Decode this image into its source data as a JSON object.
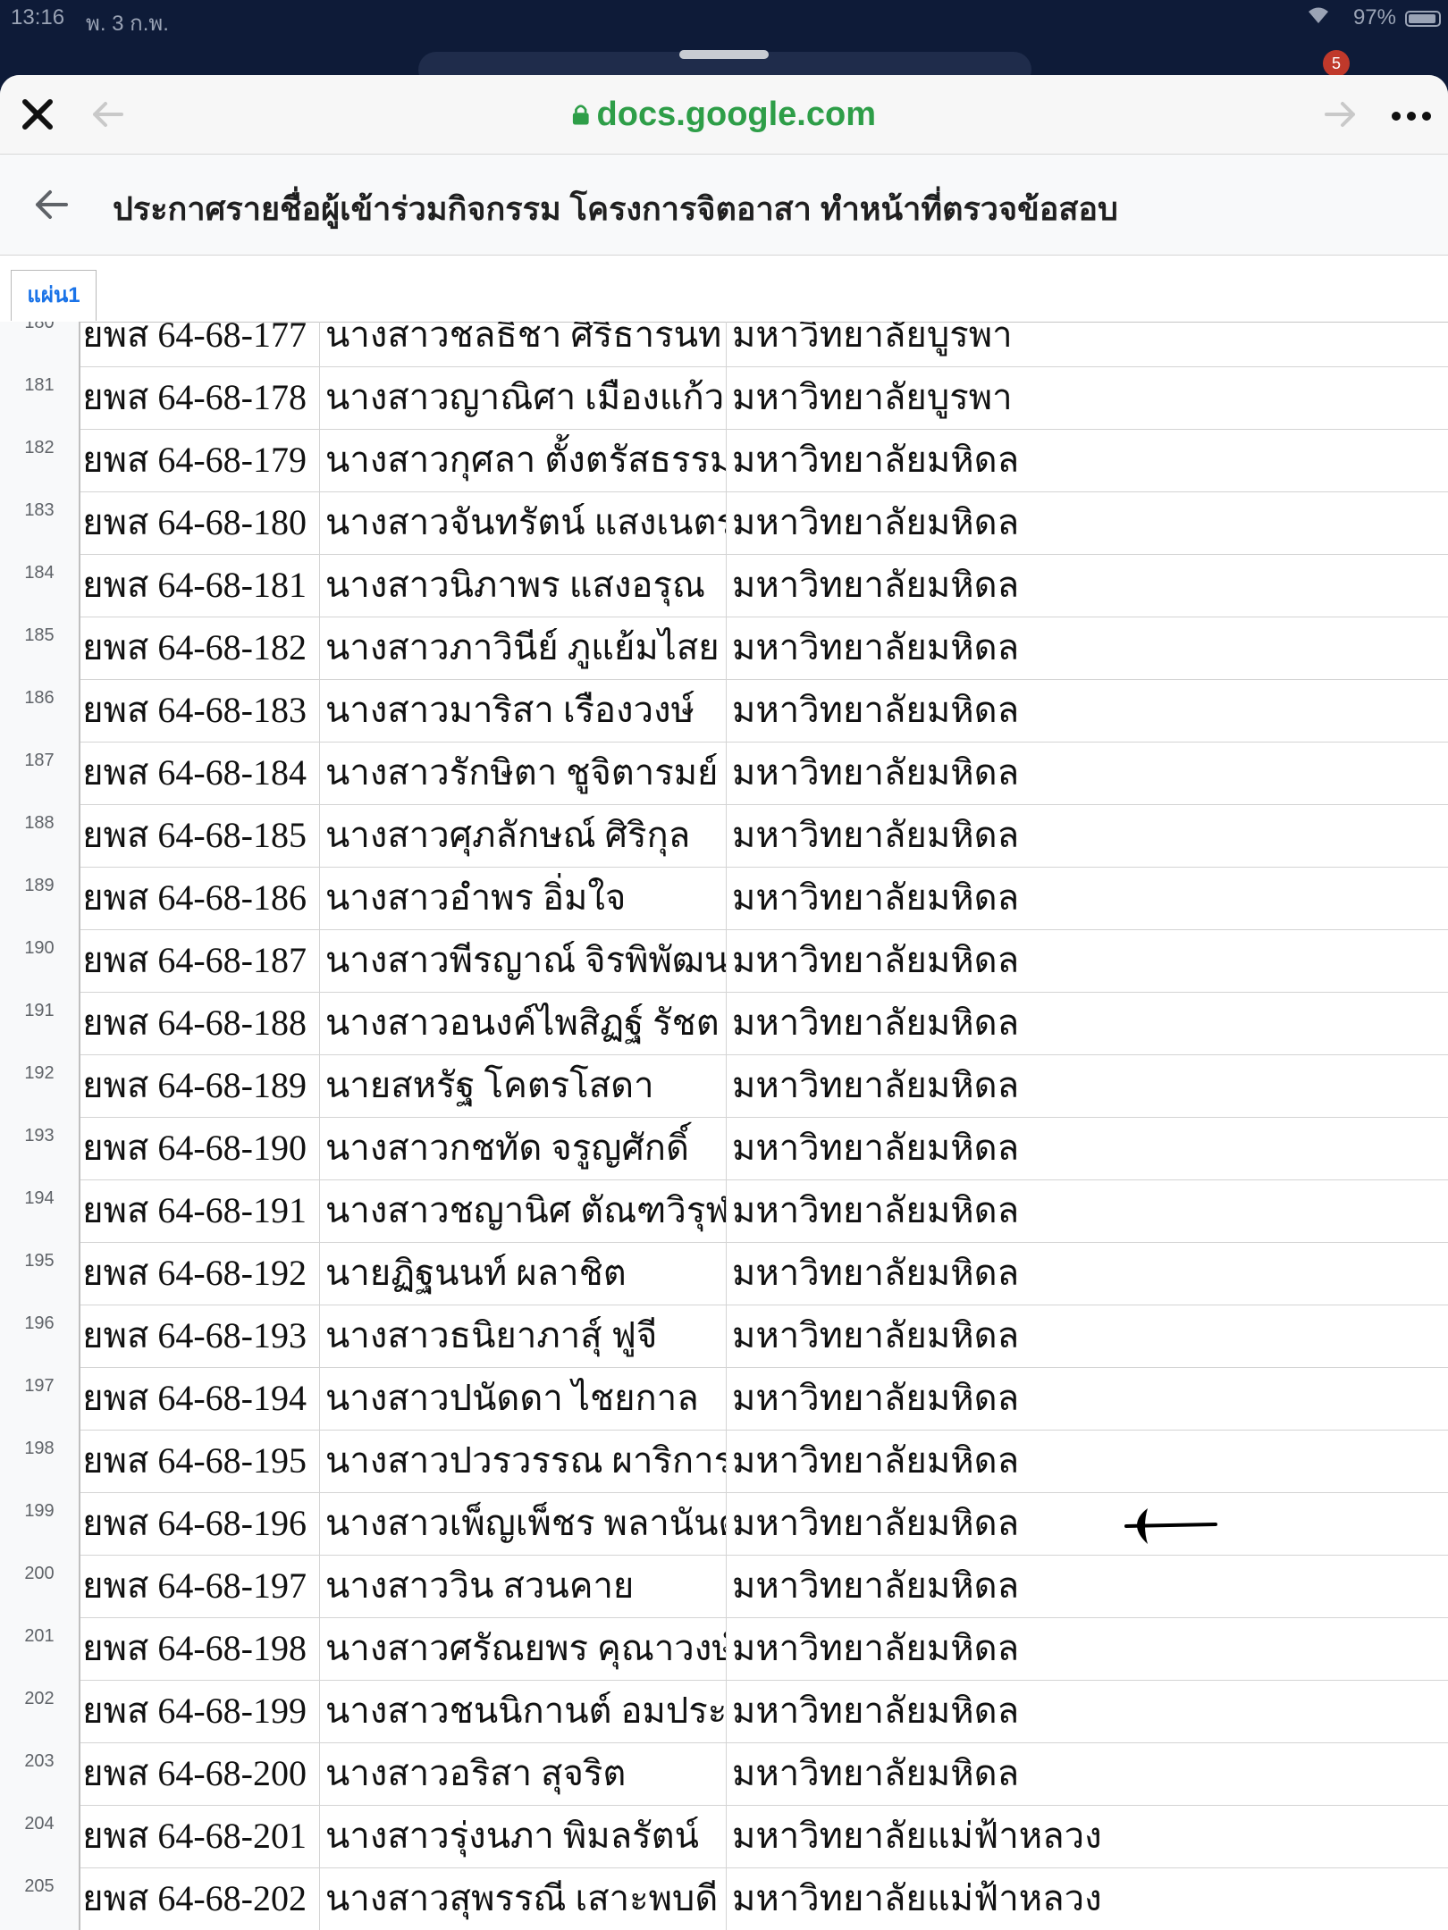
{
  "status_bar": {
    "time": "13:16",
    "date": "พ. 3 ก.พ.",
    "battery": "97%"
  },
  "background": {
    "badge": "5"
  },
  "browser": {
    "url": "docs.google.com"
  },
  "document": {
    "title": "ประกาศรายชื่อผู้เข้าร่วมกิจกรรม โครงการจิตอาสา ทำหน้าที่ตรวจข้อสอบ",
    "sheet_tab": "แผ่น1"
  },
  "rows": [
    {
      "n": "180",
      "code": "ยพส 64-68-177",
      "name": "นางสาวชลธิชา ศิริธารนท",
      "uni": "มหาวิทยาลัยบูรพา"
    },
    {
      "n": "181",
      "code": "ยพส 64-68-178",
      "name": "นางสาวญาณิศา เมืองแก้ว",
      "uni": "มหาวิทยาลัยบูรพา"
    },
    {
      "n": "182",
      "code": "ยพส 64-68-179",
      "name": "นางสาวกุศลา ตั้งตรัสธรรม",
      "uni": "มหาวิทยาลัยมหิดล"
    },
    {
      "n": "183",
      "code": "ยพส 64-68-180",
      "name": "นางสาวจันทรัตน์ แสงเนตร",
      "uni": "มหาวิทยาลัยมหิดล"
    },
    {
      "n": "184",
      "code": "ยพส 64-68-181",
      "name": "นางสาวนิภาพร แสงอรุณ",
      "uni": "มหาวิทยาลัยมหิดล"
    },
    {
      "n": "185",
      "code": "ยพส 64-68-182",
      "name": "นางสาวภาวินีย์ ภูแย้มไสย",
      "uni": "มหาวิทยาลัยมหิดล"
    },
    {
      "n": "186",
      "code": "ยพส 64-68-183",
      "name": "นางสาวมาริสา เรืองวงษ์",
      "uni": "มหาวิทยาลัยมหิดล"
    },
    {
      "n": "187",
      "code": "ยพส 64-68-184",
      "name": "นางสาวรักษิตา ชูจิตารมย์",
      "uni": "มหาวิทยาลัยมหิดล"
    },
    {
      "n": "188",
      "code": "ยพส 64-68-185",
      "name": "นางสาวศุภลักษณ์ ศิริกุล",
      "uni": "มหาวิทยาลัยมหิดล"
    },
    {
      "n": "189",
      "code": "ยพส 64-68-186",
      "name": "นางสาวอำพร อิ่มใจ",
      "uni": "มหาวิทยาลัยมหิดล"
    },
    {
      "n": "190",
      "code": "ยพส 64-68-187",
      "name": "นางสาวพีรญาณ์ จิรพิพัฒน",
      "uni": "มหาวิทยาลัยมหิดล"
    },
    {
      "n": "191",
      "code": "ยพส 64-68-188",
      "name": "นางสาวอนงค์ไพสิฏฐ์ รัชต",
      "uni": "มหาวิทยาลัยมหิดล"
    },
    {
      "n": "192",
      "code": "ยพส 64-68-189",
      "name": "นายสหรัฐ โคตรโสดา",
      "uni": "มหาวิทยาลัยมหิดล"
    },
    {
      "n": "193",
      "code": "ยพส 64-68-190",
      "name": "นางสาวกชทัด จรูญศักดิ์",
      "uni": "มหาวิทยาลัยมหิดล"
    },
    {
      "n": "194",
      "code": "ยพส 64-68-191",
      "name": "นางสาวชญานิศ ตัณฑวิรุฬ",
      "uni": "มหาวิทยาลัยมหิดล"
    },
    {
      "n": "195",
      "code": "ยพส 64-68-192",
      "name": "นายฏิฐนนท์ ผลาชิต",
      "uni": "มหาวิทยาลัยมหิดล"
    },
    {
      "n": "196",
      "code": "ยพส 64-68-193",
      "name": "นางสาวธนิยาภาสุ์ ฟูจี",
      "uni": "มหาวิทยาลัยมหิดล"
    },
    {
      "n": "197",
      "code": "ยพส 64-68-194",
      "name": "นางสาวปนัดดา ไชยกาล",
      "uni": "มหาวิทยาลัยมหิดล"
    },
    {
      "n": "198",
      "code": "ยพส 64-68-195",
      "name": "นางสาวปวรวรรณ ผาริการ",
      "uni": "มหาวิทยาลัยมหิดล"
    },
    {
      "n": "199",
      "code": "ยพส 64-68-196",
      "name": "นางสาวเพ็ญเพ็ชร พลานันต",
      "uni": "มหาวิทยาลัยมหิดล"
    },
    {
      "n": "200",
      "code": "ยพส 64-68-197",
      "name": "นางสาววิน สวนคาย",
      "uni": "มหาวิทยาลัยมหิดล"
    },
    {
      "n": "201",
      "code": "ยพส 64-68-198",
      "name": "นางสาวศรัณยพร คุณาวงษ์",
      "uni": "มหาวิทยาลัยมหิดล"
    },
    {
      "n": "202",
      "code": "ยพส 64-68-199",
      "name": "นางสาวชนนิกานต์ อมประ",
      "uni": "มหาวิทยาลัยมหิดล"
    },
    {
      "n": "203",
      "code": "ยพส 64-68-200",
      "name": "นางสาวอริสา สุจริต",
      "uni": "มหาวิทยาลัยมหิดล"
    },
    {
      "n": "204",
      "code": "ยพส 64-68-201",
      "name": "นางสาวรุ่งนภา พิมลรัตน์",
      "uni": "มหาวิทยาลัยแม่ฟ้าหลวง"
    },
    {
      "n": "205",
      "code": "ยพส 64-68-202",
      "name": "นางสาวสุพรรณี เสาะพบดี",
      "uni": "มหาวิทยาลัยแม่ฟ้าหลวง"
    }
  ]
}
